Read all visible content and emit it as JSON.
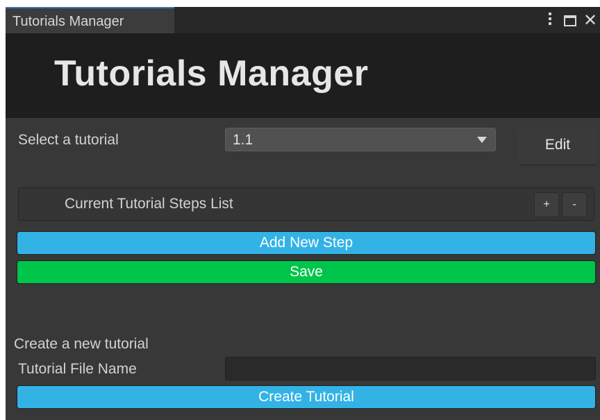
{
  "window": {
    "tab_label": "Tutorials Manager",
    "controls": [
      "kebab-menu-icon",
      "maximize-icon",
      "close-icon"
    ],
    "close_glyph": "✕"
  },
  "header": {
    "title": "Tutorials Manager"
  },
  "select_row": {
    "label": "Select a tutorial",
    "selected_value": "1.1",
    "edit_label": "Edit"
  },
  "steps_list": {
    "title": "Current Tutorial Steps List",
    "add_label": "+",
    "remove_label": "-"
  },
  "actions": {
    "add_step_label": "Add New Step",
    "save_label": "Save"
  },
  "create_section": {
    "section_label": "Create a new tutorial",
    "file_name_label": "Tutorial File Name",
    "file_name_value": "",
    "create_label": "Create Tutorial"
  },
  "colors": {
    "background": "#383838",
    "header_bg": "#1e1e1e",
    "accent_blue": "#33b2e6",
    "accent_green": "#00c54b",
    "tab_highlight": "#3a79bb"
  }
}
